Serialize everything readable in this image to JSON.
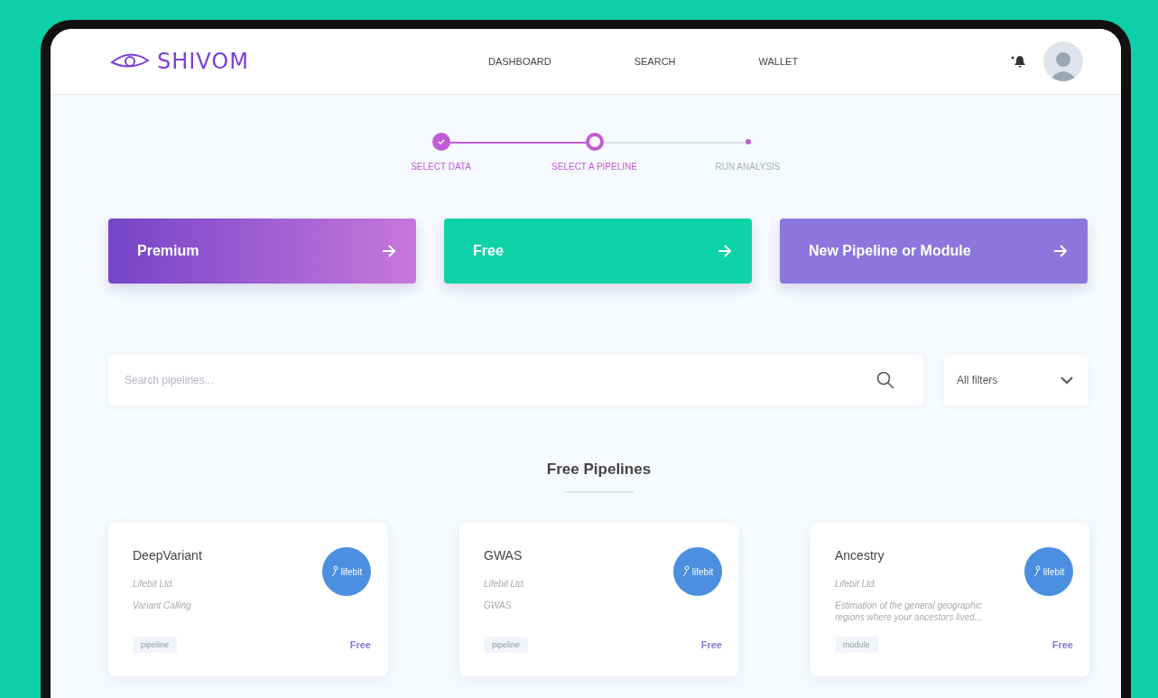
{
  "header": {
    "logo": "SHIVOM",
    "nav": [
      {
        "label": "DASHBOARD",
        "selected": false
      },
      {
        "label": "SEARCH",
        "selected": false
      },
      {
        "label": "WALLET",
        "selected": false
      }
    ]
  },
  "stepper": [
    {
      "label": "SELECT DATA",
      "completed": true,
      "selected": false
    },
    {
      "label": "SELECT A PIPELINE",
      "completed": false,
      "selected": true
    },
    {
      "label": "RUN ANALYSIS",
      "completed": false,
      "selected": false
    }
  ],
  "categories": [
    {
      "label": "Premium",
      "kind": "premium"
    },
    {
      "label": "Free",
      "kind": "free"
    },
    {
      "label": "New Pipeline or Module",
      "kind": "new"
    }
  ],
  "search": {
    "placeholder": "Search pipelines..."
  },
  "filter": {
    "value": "All filters"
  },
  "section_title": "Free Pipelines",
  "pipelines": [
    {
      "name": "DeepVariant",
      "company": "Lifebit Ltd.",
      "description": "Variant Calling",
      "logo": "lifebit",
      "tag": "pipeline",
      "price": "Free"
    },
    {
      "name": "GWAS",
      "company": "Lifebit Ltd.",
      "description": "GWAS",
      "logo": "lifebit",
      "tag": "pipeline",
      "price": "Free"
    },
    {
      "name": "Ancestry",
      "company": "Lifebit Ltd.",
      "description": "Estimation of the general geographic regions where your ancestors lived...",
      "logo": "lifebit",
      "tag": "module",
      "price": "Free"
    }
  ]
}
